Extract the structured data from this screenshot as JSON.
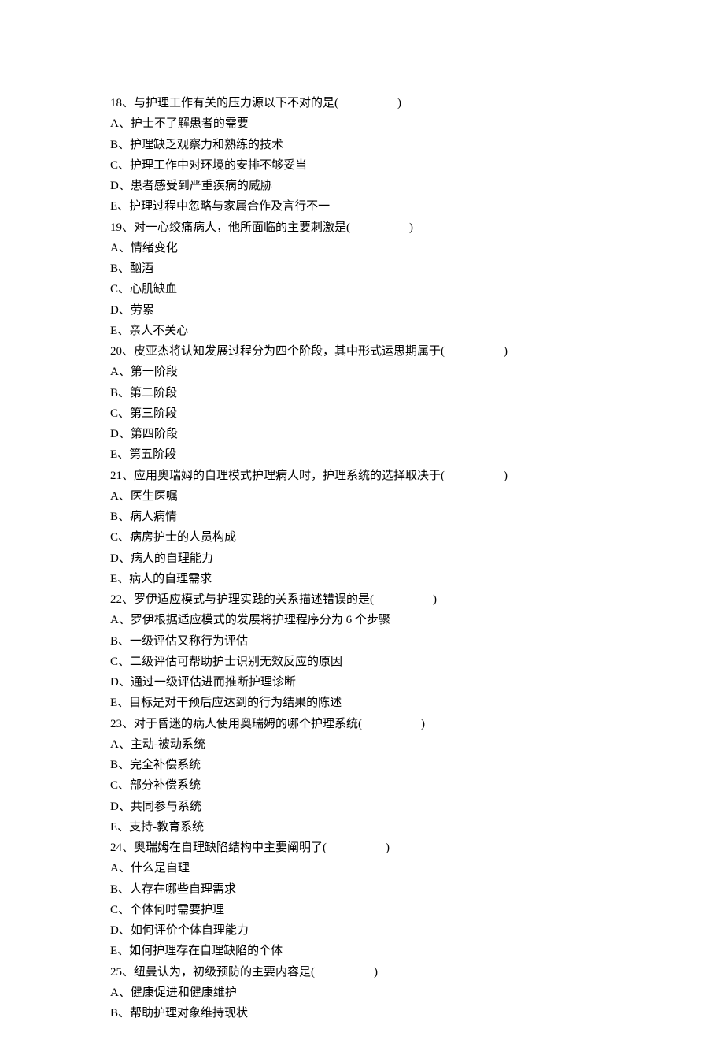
{
  "questions": [
    {
      "num": "18",
      "text": "、与护理工作有关的压力源以下不对的是(",
      "blank": "　　　　　",
      "close": ")",
      "options": [
        "A、护士不了解患者的需要",
        "B、护理缺乏观察力和熟练的技术",
        "C、护理工作中对环境的安排不够妥当",
        "D、患者感受到严重疾病的威胁",
        "E、护理过程中忽略与家属合作及言行不一"
      ]
    },
    {
      "num": "19",
      "text": "、对一心绞痛病人，他所面临的主要刺激是(",
      "blank": "　　　　　",
      "close": ")",
      "options": [
        "A、情绪变化",
        "B、酗酒",
        "C、心肌缺血",
        "D、劳累",
        "E、亲人不关心"
      ]
    },
    {
      "num": "20",
      "text": "、皮亚杰将认知发展过程分为四个阶段，其中形式运思期属于(",
      "blank": "　　　　　",
      "close": ")",
      "options": [
        "A、第一阶段",
        "B、第二阶段",
        "C、第三阶段",
        "D、第四阶段",
        "E、第五阶段"
      ]
    },
    {
      "num": "21",
      "text": "、应用奥瑞姆的自理模式护理病人时，护理系统的选择取决于(",
      "blank": "　　　　　",
      "close": ")",
      "options": [
        "A、医生医嘱",
        "B、病人病情",
        "C、病房护士的人员构成",
        "D、病人的自理能力",
        "E、病人的自理需求"
      ]
    },
    {
      "num": "22",
      "text": "、罗伊适应模式与护理实践的关系描述错误的是(",
      "blank": "　　　　　",
      "close": ")",
      "options": [
        "A、罗伊根据适应模式的发展将护理程序分为 6 个步骤",
        "B、一级评估又称行为评估",
        "C、二级评估可帮助护士识别无效反应的原因",
        "D、通过一级评估进而推断护理诊断",
        "E、目标是对干预后应达到的行为结果的陈述"
      ]
    },
    {
      "num": "23",
      "text": "、对于昏迷的病人使用奥瑞姆的哪个护理系统(",
      "blank": "　　　　　",
      "close": ")",
      "options": [
        "A、主动-被动系统",
        "B、完全补偿系统",
        "C、部分补偿系统",
        "D、共同参与系统",
        "E、支持-教育系统"
      ]
    },
    {
      "num": "24",
      "text": "、奥瑞姆在自理缺陷结构中主要阐明了(",
      "blank": "　　　　　",
      "close": ")",
      "options": [
        "A、什么是自理",
        "B、人存在哪些自理需求",
        "C、个体何时需要护理",
        "D、如何评价个体自理能力",
        "E、如何护理存在自理缺陷的个体"
      ]
    },
    {
      "num": "25",
      "text": "、纽曼认为，初级预防的主要内容是(",
      "blank": "　　　　　",
      "close": ")",
      "options": [
        "A、健康促进和健康维护",
        "B、帮助护理对象维持现状"
      ]
    }
  ]
}
